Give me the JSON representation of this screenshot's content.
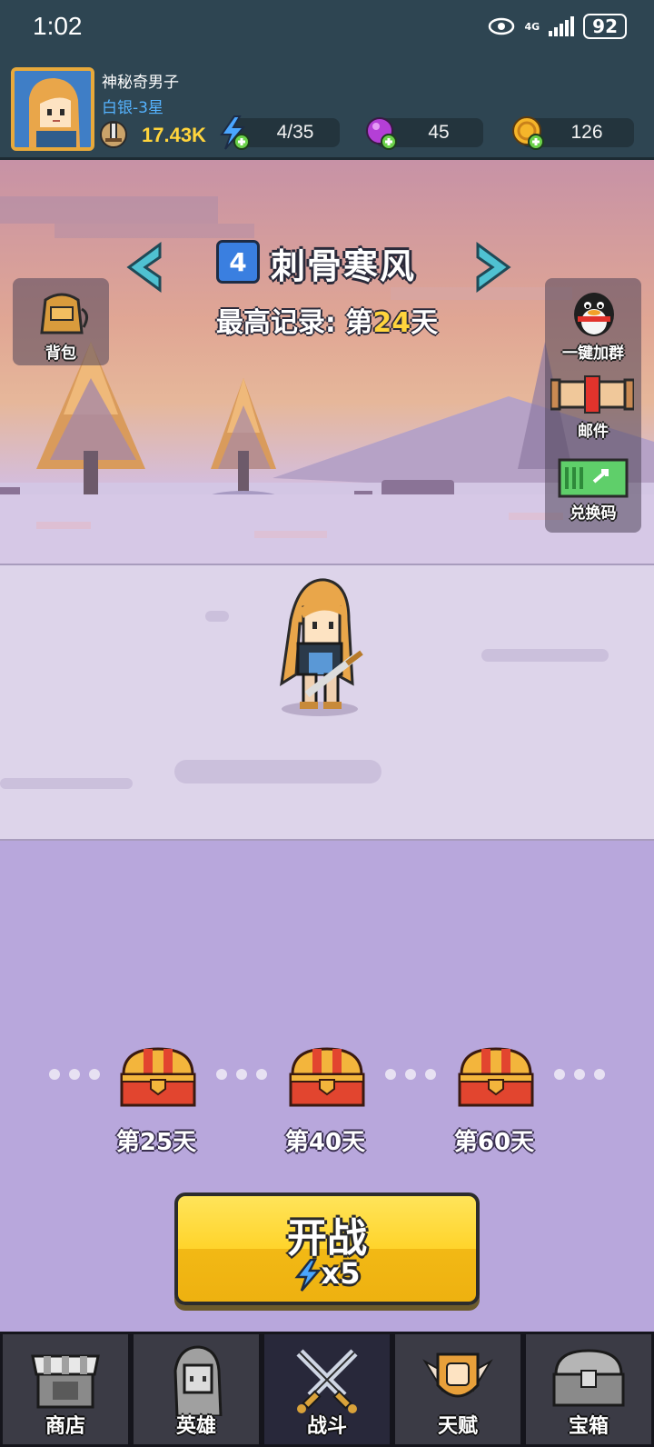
{
  "status_bar": {
    "time": "1:02",
    "network": "4G",
    "battery": "92"
  },
  "player": {
    "name": "神秘奇男子",
    "rank": "白银-3星",
    "power": "17.43K"
  },
  "resources": {
    "energy": "4/35",
    "gems": "45",
    "coins": "126"
  },
  "stage": {
    "number": "4",
    "name": "刺骨寒风",
    "record_prefix": "最高记录: 第",
    "record_day": "24",
    "record_suffix": "天"
  },
  "side_buttons": {
    "backpack": "背包",
    "join_group": "一键加群",
    "mail": "邮件",
    "redeem": "兑换码"
  },
  "chests": [
    {
      "label": "第25天"
    },
    {
      "label": "第40天"
    },
    {
      "label": "第60天"
    }
  ],
  "start_button": {
    "title": "开战",
    "cost": "x5"
  },
  "tabs": [
    {
      "label": "商店",
      "icon": "shop-icon"
    },
    {
      "label": "英雄",
      "icon": "hero-icon"
    },
    {
      "label": "战斗",
      "icon": "crossed-swords-icon"
    },
    {
      "label": "天赋",
      "icon": "talent-fist-icon"
    },
    {
      "label": "宝箱",
      "icon": "chest-icon"
    }
  ],
  "active_tab": "战斗",
  "colors": {
    "header_bg": "#2e4552",
    "accent_yellow": "#ffd42b",
    "stage_blue": "#3a7fe0",
    "bg_lilac": "#b8a7dc"
  }
}
